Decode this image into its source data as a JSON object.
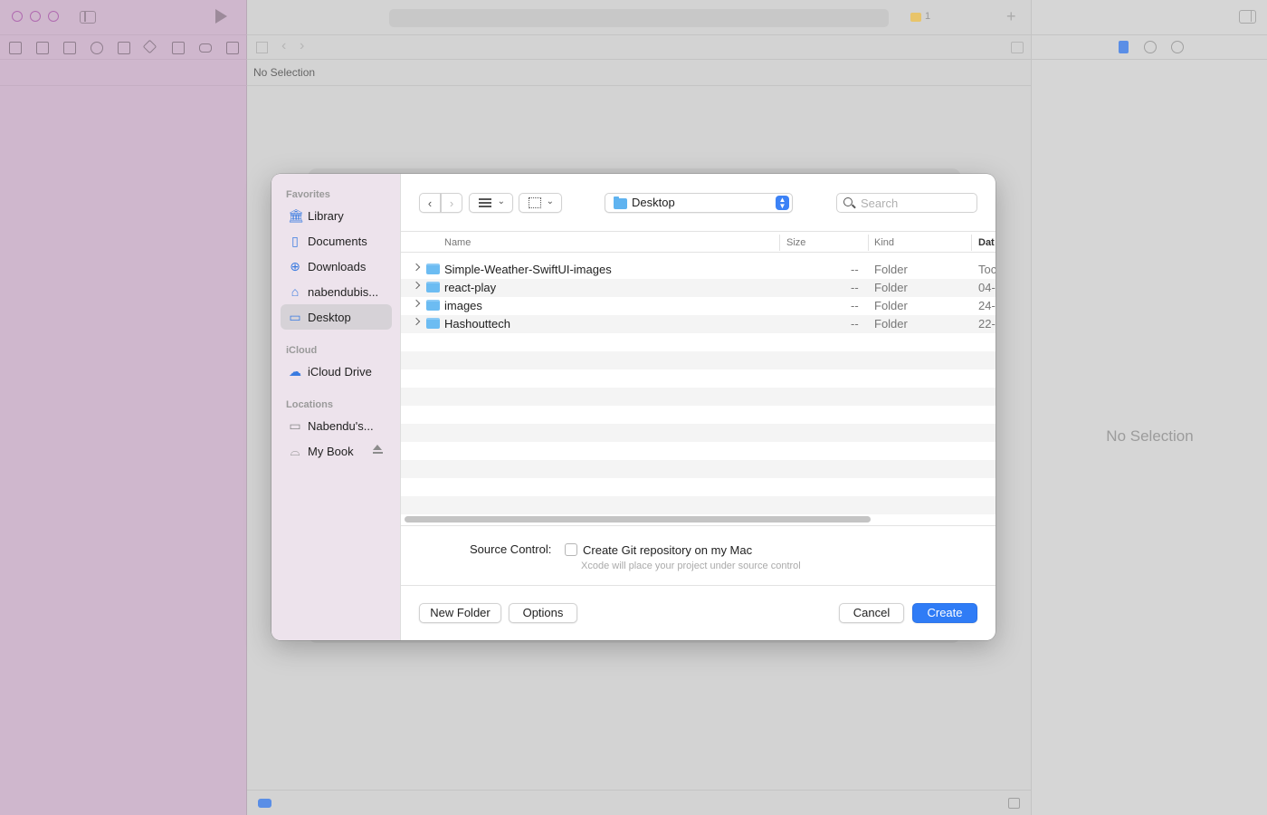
{
  "xcode": {
    "jumpbar_text": "No Selection",
    "inspector_empty": "No Selection",
    "warning_count": "1",
    "plus_label": "+"
  },
  "sidebar": {
    "favorites_title": "Favorites",
    "icloud_title": "iCloud",
    "locations_title": "Locations",
    "favorites": [
      {
        "label": "Library",
        "icon": "library-icon"
      },
      {
        "label": "Documents",
        "icon": "document-icon"
      },
      {
        "label": "Downloads",
        "icon": "download-icon"
      },
      {
        "label": "nabendubis...",
        "icon": "home-icon"
      },
      {
        "label": "Desktop",
        "icon": "desktop-icon",
        "selected": true
      }
    ],
    "icloud": [
      {
        "label": "iCloud Drive",
        "icon": "cloud-icon"
      }
    ],
    "locations": [
      {
        "label": "Nabendu's...",
        "icon": "disk-icon"
      },
      {
        "label": "My Book",
        "icon": "external-drive-icon"
      }
    ]
  },
  "toolbar": {
    "location": "Desktop",
    "search_placeholder": "Search"
  },
  "columns": {
    "name": "Name",
    "size": "Size",
    "kind": "Kind",
    "date": "Dat"
  },
  "files": [
    {
      "name": "Simple-Weather-SwiftUI-images",
      "size": "--",
      "kind": "Folder",
      "date": "Toc"
    },
    {
      "name": "react-play",
      "size": "--",
      "kind": "Folder",
      "date": "04-"
    },
    {
      "name": "images",
      "size": "--",
      "kind": "Folder",
      "date": "24-"
    },
    {
      "name": "Hashouttech",
      "size": "--",
      "kind": "Folder",
      "date": "22-"
    }
  ],
  "source_control": {
    "label": "Source Control:",
    "checkbox_label": "Create Git repository on my Mac",
    "hint": "Xcode will place your project under source control",
    "checked": false
  },
  "buttons": {
    "new_folder": "New Folder",
    "options": "Options",
    "cancel": "Cancel",
    "create": "Create"
  },
  "colors": {
    "accent": "#2f7cf6",
    "sidebar_bg": "#ede3ec",
    "xcode_navigator_bg": "#cfb7cd"
  }
}
